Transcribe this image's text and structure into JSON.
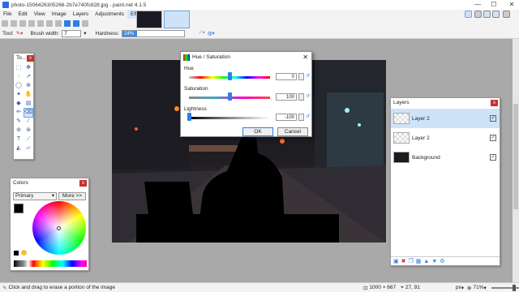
{
  "window": {
    "title": "photo-1506426305266-2b7e740fc828.jpg - paint.net 4.1.5",
    "minimize": "—",
    "maximize": "☐",
    "close": "✕"
  },
  "menu": [
    "File",
    "Edit",
    "View",
    "Image",
    "Layers",
    "Adjustments",
    "Effects"
  ],
  "toolbar": {
    "tool_label": "Tool:",
    "brush_width_label": "Brush width:",
    "brush_width_value": "7",
    "hardness_label": "Hardness:",
    "hardness_value": "24%",
    "hardness_fraction": 0.24
  },
  "tools_panel": {
    "title": "To..."
  },
  "hue_saturation": {
    "title": "Hue / Saturation",
    "hue_label": "Hue",
    "hue_value": "0",
    "hue_fraction": 0.5,
    "saturation_label": "Saturation",
    "saturation_value": "100",
    "saturation_fraction": 0.5,
    "lightness_label": "Lightness",
    "lightness_value": "-100",
    "lightness_fraction": 0.0,
    "ok_label": "OK",
    "cancel_label": "Cancel"
  },
  "layers_panel": {
    "title": "Layers",
    "layers": [
      {
        "name": "Layer 2",
        "checked": "✓"
      },
      {
        "name": "Layer 2",
        "checked": "✓"
      },
      {
        "name": "Background",
        "checked": "✓"
      }
    ]
  },
  "colors_panel": {
    "title": "Colors",
    "mode": "Primary",
    "more_label": "More >>"
  },
  "status": {
    "hint": "Click and drag to erase a portion of the image",
    "size": "1000 × 667",
    "position": "27, 91",
    "unit": "px",
    "zoom": "71%"
  },
  "colors": {
    "accent": "#3d8de6",
    "close_red": "#c8302c",
    "selection": "#cfe3f8"
  }
}
